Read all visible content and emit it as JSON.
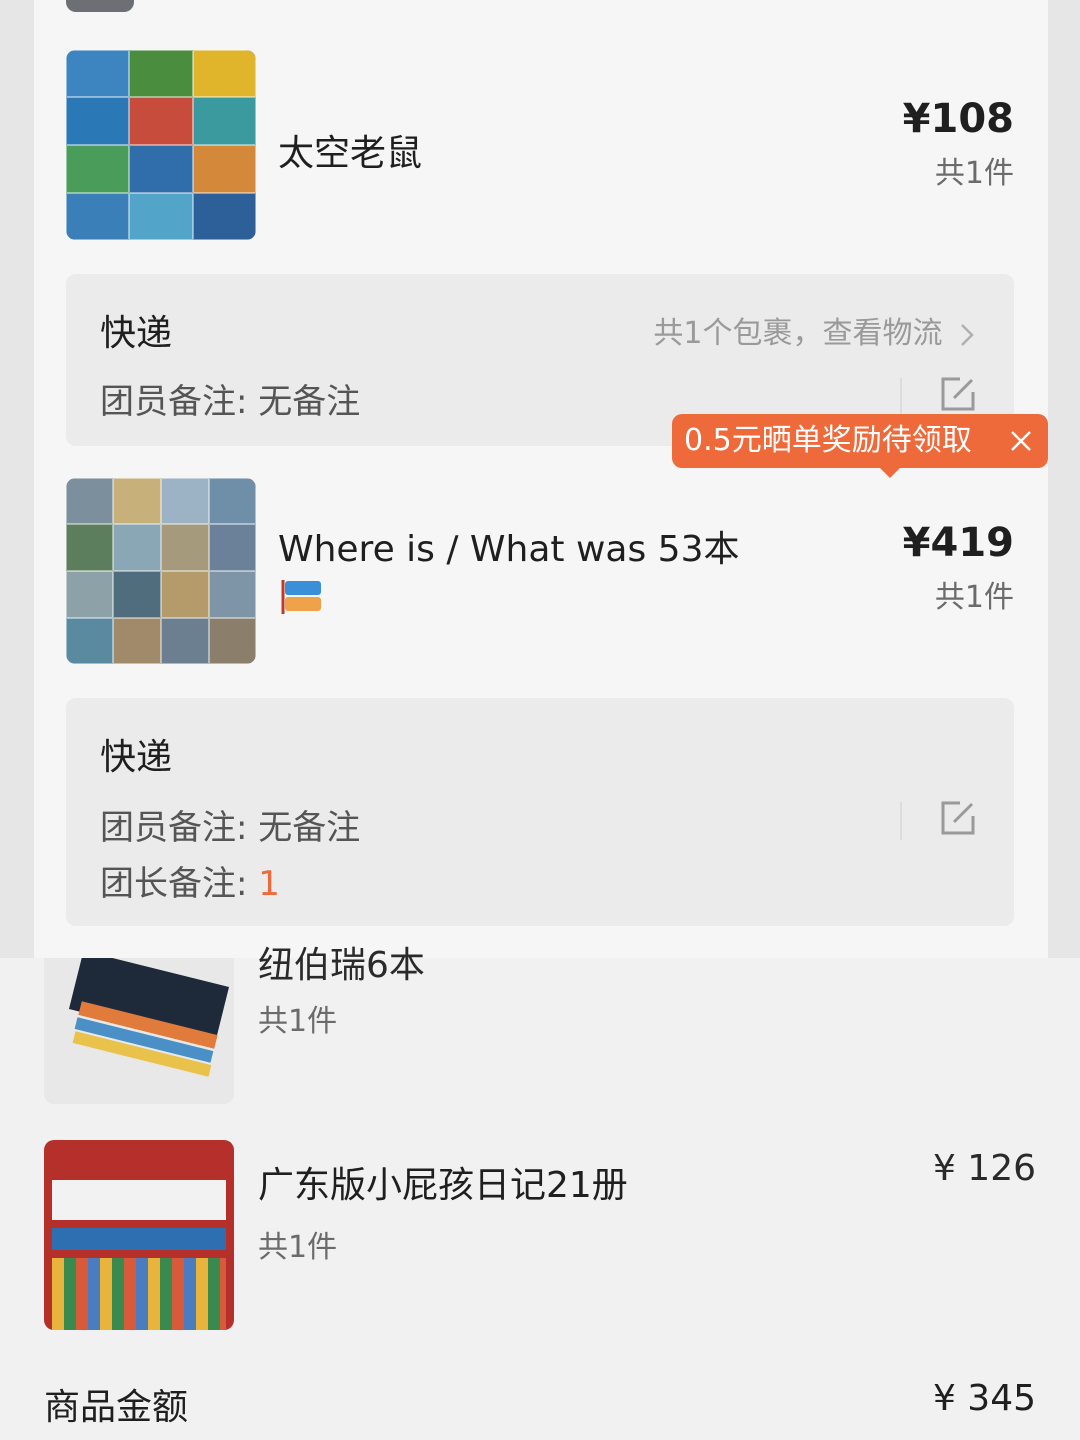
{
  "orders": [
    {
      "title": "太空老鼠",
      "price": "¥108",
      "qty": "共1件",
      "shipping": {
        "method": "快递",
        "logistics": "共1个包裹，查看物流",
        "member_note": "团员备注: 无备注"
      }
    },
    {
      "title": "Where is / What was 53本",
      "price": "¥419",
      "qty": "共1件",
      "shipping": {
        "method": "快递",
        "member_note": "团员备注: 无备注",
        "leader_note_label": "团长备注: ",
        "leader_note_value": "1"
      }
    }
  ],
  "reward_tip": "0.5元晒单奖励待领取",
  "second_list": [
    {
      "title": "纽伯瑞6本",
      "qty": "共1件"
    },
    {
      "title": "广东版小屁孩日记21册",
      "qty": "共1件",
      "price": "¥ 126"
    }
  ],
  "summary": {
    "label": "商品金额",
    "value": "¥ 345"
  },
  "colors": {
    "accent_orange": "#ee6a3b",
    "card_bg": "#f6f6f6",
    "ship_bg": "#ebebeb"
  },
  "icons": [
    "edit-icon",
    "chevron-right-icon",
    "close-icon",
    "flag-badge-icon"
  ]
}
